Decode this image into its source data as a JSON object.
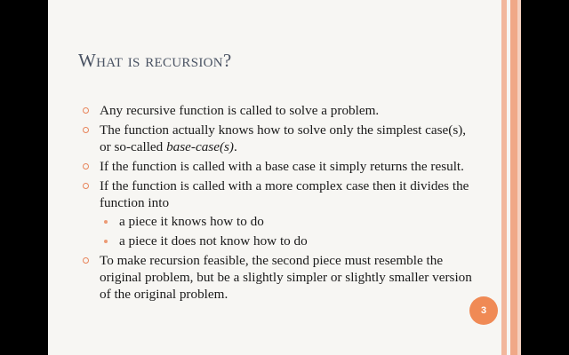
{
  "slide": {
    "title": "What is recursion?",
    "bullets": [
      {
        "text": "Any recursive function is called to solve a problem."
      },
      {
        "text": "The function actually knows how to solve only the simplest case(s), or so-called ",
        "emphasis": "base-case(s)",
        "tail": "."
      },
      {
        "text": "If the function is called with a base case it simply returns the result."
      },
      {
        "text": "If the function is called with a more complex case then it divides the function into",
        "sub_bullets": [
          {
            "text": "a piece it knows how to do"
          },
          {
            "text": "a piece it does not know how to do"
          }
        ]
      },
      {
        "text": "To make recursion feasible, the second piece must resemble the original problem, but be a slightly simpler or slightly smaller version of the original problem."
      }
    ],
    "slide_number": "3"
  },
  "colors": {
    "title": "#4a5363",
    "accent": "#f08a55",
    "bullet_ring": "#e8845a",
    "background": "#f7f6f3"
  }
}
